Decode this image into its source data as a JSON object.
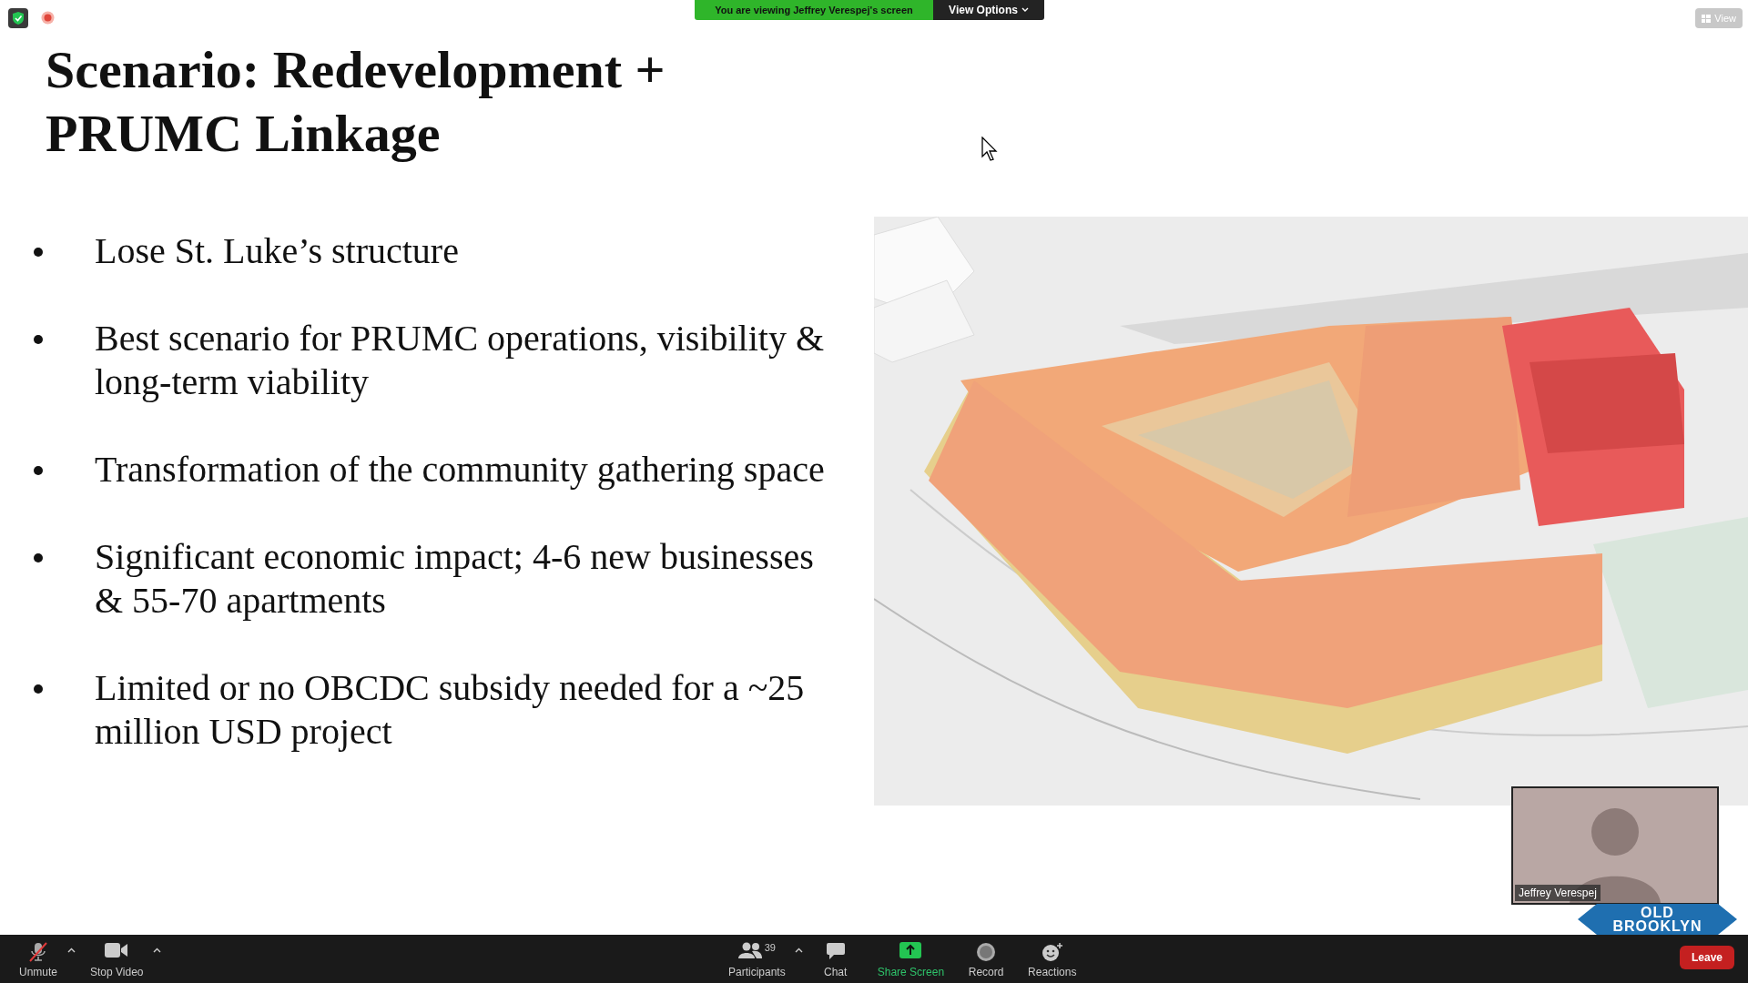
{
  "meeting": {
    "share_banner": "You are viewing Jeffrey Verespej's screen",
    "view_options": "View Options",
    "view_button": "View"
  },
  "slide": {
    "title": "Scenario: Redevelopment + PRUMC Linkage",
    "bullets": [
      "Lose St. Luke’s structure",
      "Best scenario for PRUMC operations, visibility & long-term viability",
      "Transformation of the community gathering space",
      "Significant economic impact; 4-6 new businesses & 55-70 apartments",
      "Limited or no OBCDC subsidy needed for a ~25 million USD project"
    ],
    "logo": [
      "OLD",
      "BROOKLYN"
    ]
  },
  "video_tile": {
    "name": "Jeffrey Verespej"
  },
  "toolbar": {
    "left": [
      {
        "kind": "mic",
        "label": "Unmute",
        "muted": true,
        "has_menu": true
      },
      {
        "kind": "video",
        "label": "Stop Video",
        "has_menu": true
      }
    ],
    "center": [
      {
        "kind": "participants",
        "label": "Participants",
        "count": "39",
        "has_menu": true
      },
      {
        "kind": "chat",
        "label": "Chat",
        "has_menu": false
      },
      {
        "kind": "share",
        "label": "Share Screen",
        "has_menu": false
      },
      {
        "kind": "record",
        "label": "Record",
        "has_menu": false
      },
      {
        "kind": "reactions",
        "label": "Reactions",
        "has_menu": false
      }
    ],
    "leave": "Leave"
  }
}
